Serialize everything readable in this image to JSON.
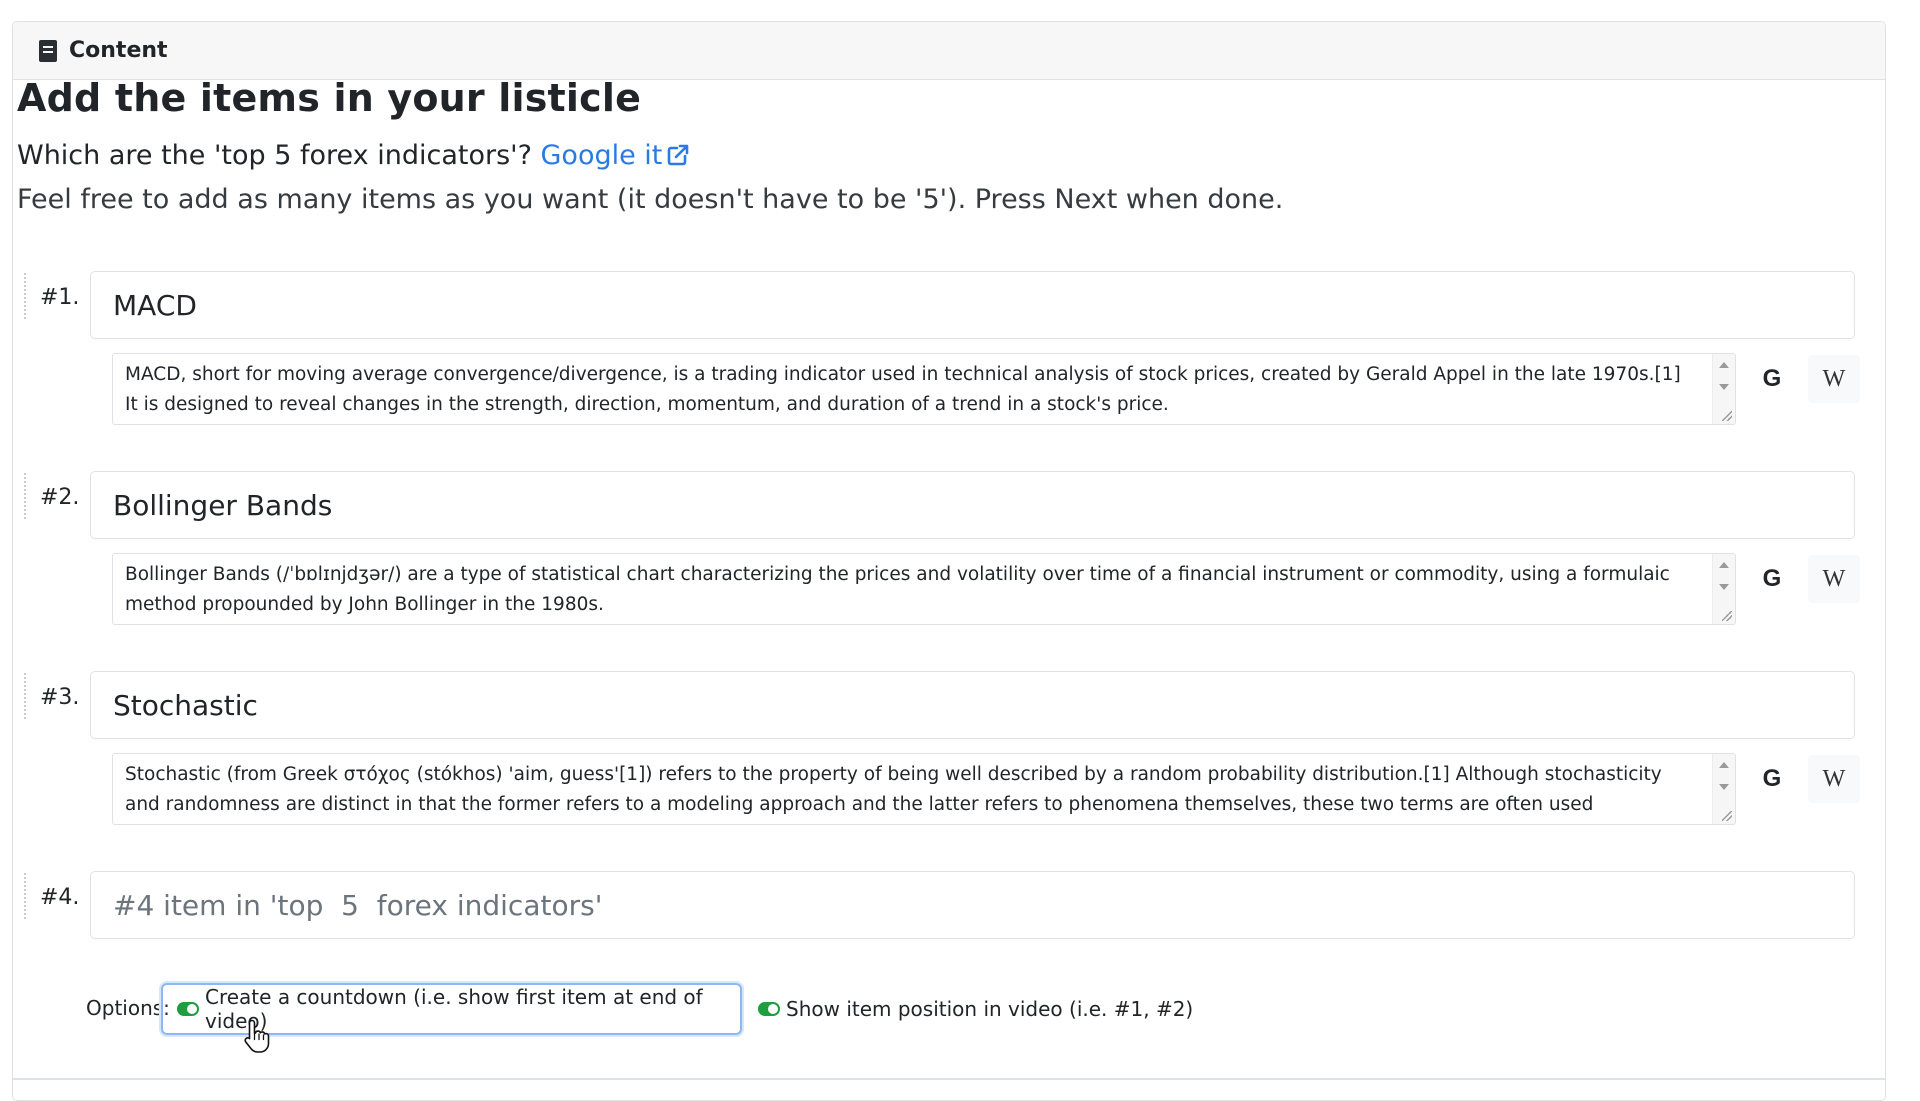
{
  "header": {
    "title": "Content",
    "icon": "book-icon"
  },
  "main": {
    "heading": "Add the items in your listicle",
    "question_prefix": "Which are the 'top 5 forex indicators'?",
    "google_link": "Google it",
    "instruction": "Feel free to add as many items as you want (it doesn't have to be '5'). Press Next when done."
  },
  "items": [
    {
      "number": "#1.",
      "title": "MACD",
      "description": "MACD, short for moving average convergence/divergence, is a trading indicator used in technical analysis of stock prices, created by Gerald Appel in the late 1970s.[1] It is designed to reveal changes in the strength, direction, momentum, and duration of a trend in a stock's price.",
      "google_button": "G",
      "wiki_button": "W"
    },
    {
      "number": "#2.",
      "title": "Bollinger Bands",
      "description": "Bollinger Bands (/ˈbɒlɪnjdʒər/) are a type of statistical chart characterizing the prices and volatility over time of a financial instrument or commodity, using a formulaic method propounded by John Bollinger in the 1980s.",
      "google_button": "G",
      "wiki_button": "W"
    },
    {
      "number": "#3.",
      "title": "Stochastic",
      "description": "Stochastic (from Greek στόχος (stókhos) 'aim, guess'[1]) refers to the property of being well described by a random probability distribution.[1] Although stochasticity and randomness are distinct in that the former refers to a modeling approach and the latter refers to phenomena themselves, these two terms are often used synonymously.",
      "google_button": "G",
      "wiki_button": "W"
    },
    {
      "number": "#4.",
      "title": "",
      "placeholder": "#4 item in 'top  5  forex indicators'"
    }
  ],
  "options": {
    "label": "Options:",
    "countdown": "Create a countdown (i.e. show first item at end of video)",
    "countdown_on": true,
    "show_position": "Show item position in video (i.e. #1, #2)",
    "show_position_on": true
  },
  "colors": {
    "link": "#2a7ae4",
    "toggle_on": "#1e9e3e",
    "focus_ring": "#8bb8f5"
  }
}
